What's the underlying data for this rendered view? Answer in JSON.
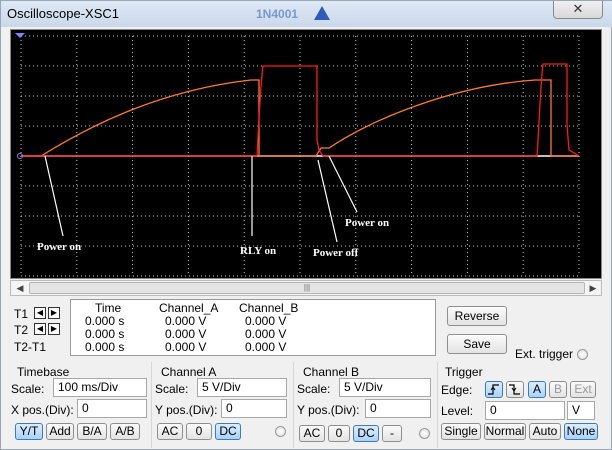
{
  "window": {
    "title": "Oscilloscope-XSC1",
    "close_symbol": "✕"
  },
  "background_strip": {
    "label": "1N4001"
  },
  "colors": {
    "grid": "#c8c8c8",
    "channel_a": "#ff7a2a",
    "channel_b": "#ff1a1a",
    "baseline": "#ffffff",
    "annotation": "#ffffff"
  },
  "screen": {
    "annotations": [
      {
        "text": "Power on"
      },
      {
        "text": "RLY on"
      },
      {
        "text": "Power off"
      },
      {
        "text": "Power on"
      }
    ]
  },
  "cursors": {
    "t1_label": "T1",
    "t2_label": "T2",
    "t2t1_label": "T2-T1"
  },
  "readout": {
    "headers": [
      "Time",
      "Channel_A",
      "Channel_B"
    ],
    "rows": [
      [
        "0.000 s",
        "0.000 V",
        "0.000 V"
      ],
      [
        "0.000 s",
        "0.000 V",
        "0.000 V"
      ],
      [
        "0.000 s",
        "0.000 V",
        "0.000 V"
      ]
    ]
  },
  "side_buttons": {
    "reverse": "Reverse",
    "save": "Save",
    "ext_trigger": "Ext. trigger"
  },
  "timebase": {
    "title": "Timebase",
    "scale_label": "Scale:",
    "scale_value": "100 ms/Div",
    "xpos_label": "X pos.(Div):",
    "xpos_value": "0",
    "modes": [
      "Y/T",
      "Add",
      "B/A",
      "A/B"
    ],
    "selected_mode": "Y/T"
  },
  "channel_a": {
    "title": "Channel A",
    "scale_label": "Scale:",
    "scale_value": "5  V/Div",
    "ypos_label": "Y pos.(Div):",
    "ypos_value": "0",
    "coupling": [
      "AC",
      "0",
      "DC"
    ],
    "selected": "DC"
  },
  "channel_b": {
    "title": "Channel B",
    "scale_label": "Scale:",
    "scale_value": "5  V/Div",
    "ypos_label": "Y pos.(Div):",
    "ypos_value": "0",
    "coupling": [
      "AC",
      "0",
      "DC",
      "-"
    ],
    "selected": "DC"
  },
  "trigger": {
    "title": "Trigger",
    "edge_label": "Edge:",
    "edge_sources": [
      "A",
      "B",
      "Ext"
    ],
    "selected_source": "A",
    "level_label": "Level:",
    "level_value": "0",
    "level_unit": "V",
    "modes": [
      "Single",
      "Normal",
      "Auto",
      "None"
    ],
    "selected_mode": "None"
  }
}
